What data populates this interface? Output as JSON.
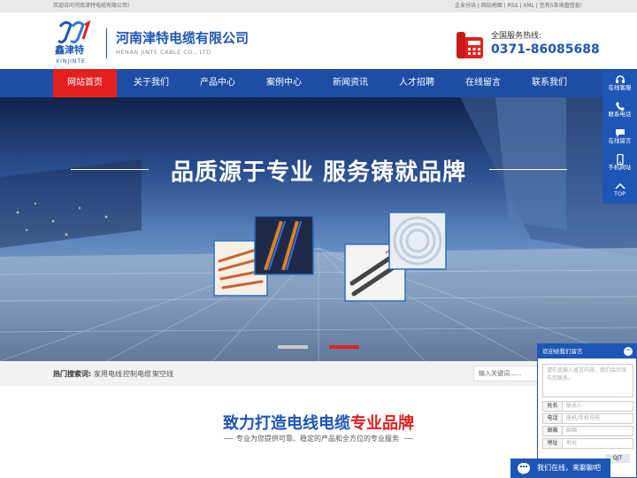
{
  "topbar": {
    "welcome": "欢迎访问河南津特电缆有限公司!",
    "links": "企业分站 | 网站地图 | RSS | XML | 您有5条询盘信息!"
  },
  "header": {
    "logo_cn": "鑫津特",
    "logo_en": "XINJINTE",
    "company_cn": "河南津特电缆有限公司",
    "company_en": "HENAN JINTE CABLE CO., LTD",
    "hotline_label": "全国服务热线:",
    "hotline_number": "0371-86085688"
  },
  "nav": {
    "items": [
      {
        "label": "网站首页"
      },
      {
        "label": "关于我们"
      },
      {
        "label": "产品中心"
      },
      {
        "label": "案例中心"
      },
      {
        "label": "新闻资讯"
      },
      {
        "label": "人才招聘"
      },
      {
        "label": "在线留言"
      },
      {
        "label": "联系我们"
      }
    ],
    "active_index": 0
  },
  "banner": {
    "slogan": "品质源于专业 服务铸就品牌"
  },
  "search": {
    "hot_label": "热门搜索词:",
    "keywords": [
      "家用电线",
      "控制电缆",
      "架空线"
    ],
    "placeholder": "输入关键词......"
  },
  "section": {
    "title_blue": "致力打造电线电缆",
    "title_red": "专业品牌",
    "subtitle": "专业为您提供可靠、稳定的产品和全方位的专业服务"
  },
  "float_bar": {
    "items": [
      {
        "label": "在线客服",
        "icon": "headset-icon"
      },
      {
        "label": "联系电话",
        "icon": "phone-icon"
      },
      {
        "label": "在线留言",
        "icon": "message-icon"
      },
      {
        "label": "手机网站",
        "icon": "mobile-icon"
      },
      {
        "label": "TOP",
        "icon": "up-arrow-icon"
      }
    ]
  },
  "chat": {
    "title": "欢迎给我们留言",
    "textarea_placeholder": "请在此输入留言内容，我们会尽快与您联系。",
    "fields": [
      {
        "label": "姓名",
        "placeholder": "联系人"
      },
      {
        "label": "电话",
        "placeholder": "座机/手机号码"
      },
      {
        "label": "邮箱",
        "placeholder": "邮箱"
      },
      {
        "label": "地址",
        "placeholder": "地址"
      }
    ],
    "captcha": "QJT",
    "bottom_text": "我们在线，来聊聊吧"
  },
  "colors": {
    "brand_blue": "#1d56b5",
    "nav_blue": "#1d4da5",
    "active_red": "#e3201f"
  }
}
